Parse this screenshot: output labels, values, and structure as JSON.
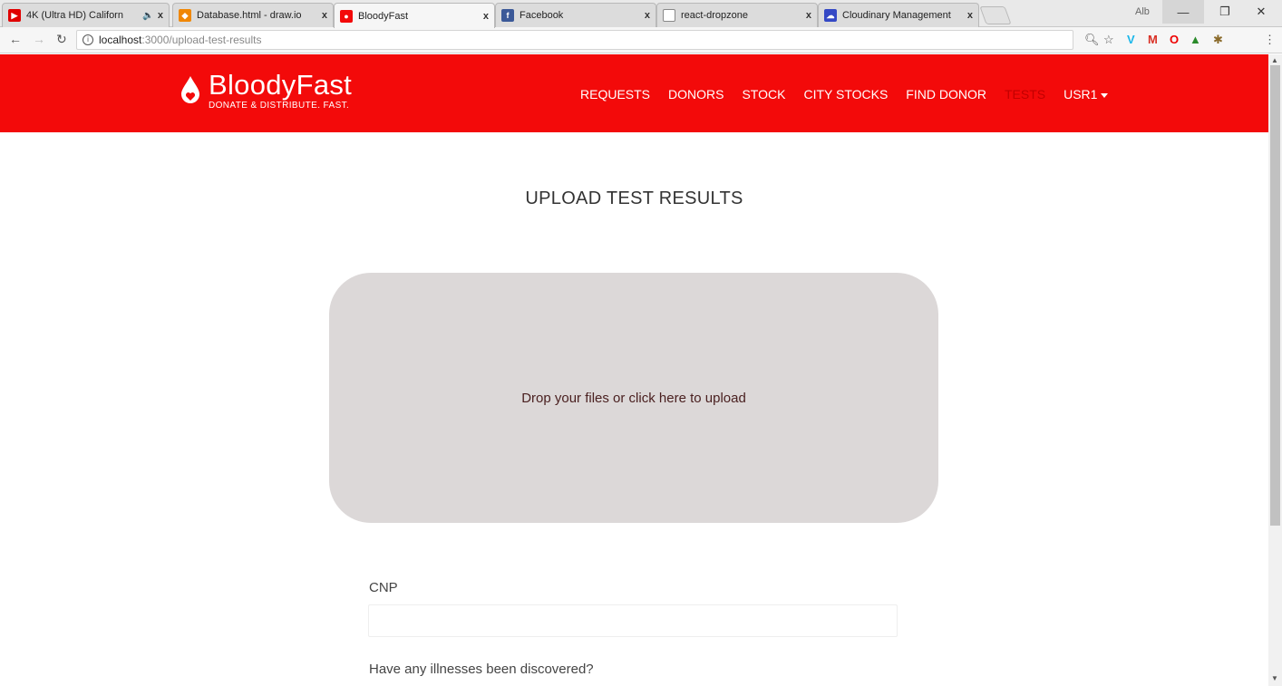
{
  "browser": {
    "tabs": [
      {
        "label": "4K (Ultra HD) Californ",
        "extra": "🔈",
        "icon": "youtube-icon",
        "color": "#e00000"
      },
      {
        "label": "Database.html - draw.io",
        "icon": "drawio-icon",
        "color": "#f08705"
      },
      {
        "label": "BloodyFast",
        "icon": "bloodyfast-icon",
        "color": "#f30a0a",
        "active": true
      },
      {
        "label": "Facebook",
        "icon": "facebook-icon",
        "color": "#3b5998"
      },
      {
        "label": "react-dropzone",
        "icon": "page-icon",
        "color": "#888888"
      },
      {
        "label": "Cloudinary Management",
        "icon": "cloudinary-icon",
        "color": "#3448c5"
      }
    ],
    "close_glyph": "x",
    "user_label": "Alb",
    "url_host": "localhost",
    "url_path": ":3000/upload-test-results"
  },
  "header": {
    "brand_name": "BloodyFast",
    "tagline": "DONATE & DISTRIBUTE. FAST.",
    "nav": [
      {
        "label": "REQUESTS"
      },
      {
        "label": "DONORS"
      },
      {
        "label": "STOCK"
      },
      {
        "label": "CITY STOCKS"
      },
      {
        "label": "FIND DONOR"
      },
      {
        "label": "TESTS",
        "active": true
      },
      {
        "label": "USR1",
        "dropdown": true
      }
    ]
  },
  "main": {
    "title": "UPLOAD TEST RESULTS",
    "dropzone_text": "Drop your files or click here to upload",
    "cnp_label": "CNP",
    "cnp_value": "",
    "illness_label": "Have any illnesses been discovered?"
  },
  "colors": {
    "brand": "#f30a0a",
    "active_nav": "#c20000",
    "dropzone_bg": "#dcd8d8"
  }
}
